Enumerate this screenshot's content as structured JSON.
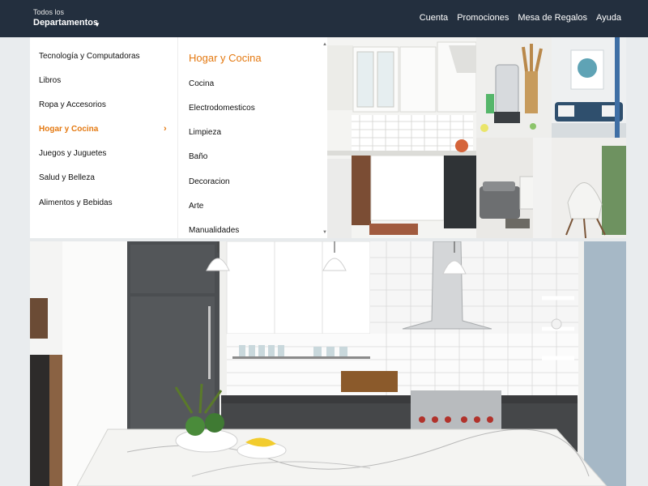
{
  "header": {
    "dept_small": "Todos los",
    "dept_big": "Departamentos",
    "links": [
      "Cuenta",
      "Promociones",
      "Mesa de Regalos",
      "Ayuda"
    ]
  },
  "menu": {
    "categories": [
      "Tecnología y Computadoras",
      "Libros",
      "Ropa y Accesorios",
      "Hogar y Cocina",
      "Juegos y Juguetes",
      "Salud y Belleza",
      "Alimentos y Bebidas"
    ],
    "active_category": "Hogar y Cocina",
    "subcategory_title": "Hogar y Cocina",
    "subcategories": [
      "Cocina",
      "Electrodomesticos",
      "Limpieza",
      "Baño",
      "Decoracion",
      "Arte",
      "Manualidades"
    ]
  },
  "colors": {
    "topbar": "#232f3e",
    "accent": "#e47911"
  }
}
